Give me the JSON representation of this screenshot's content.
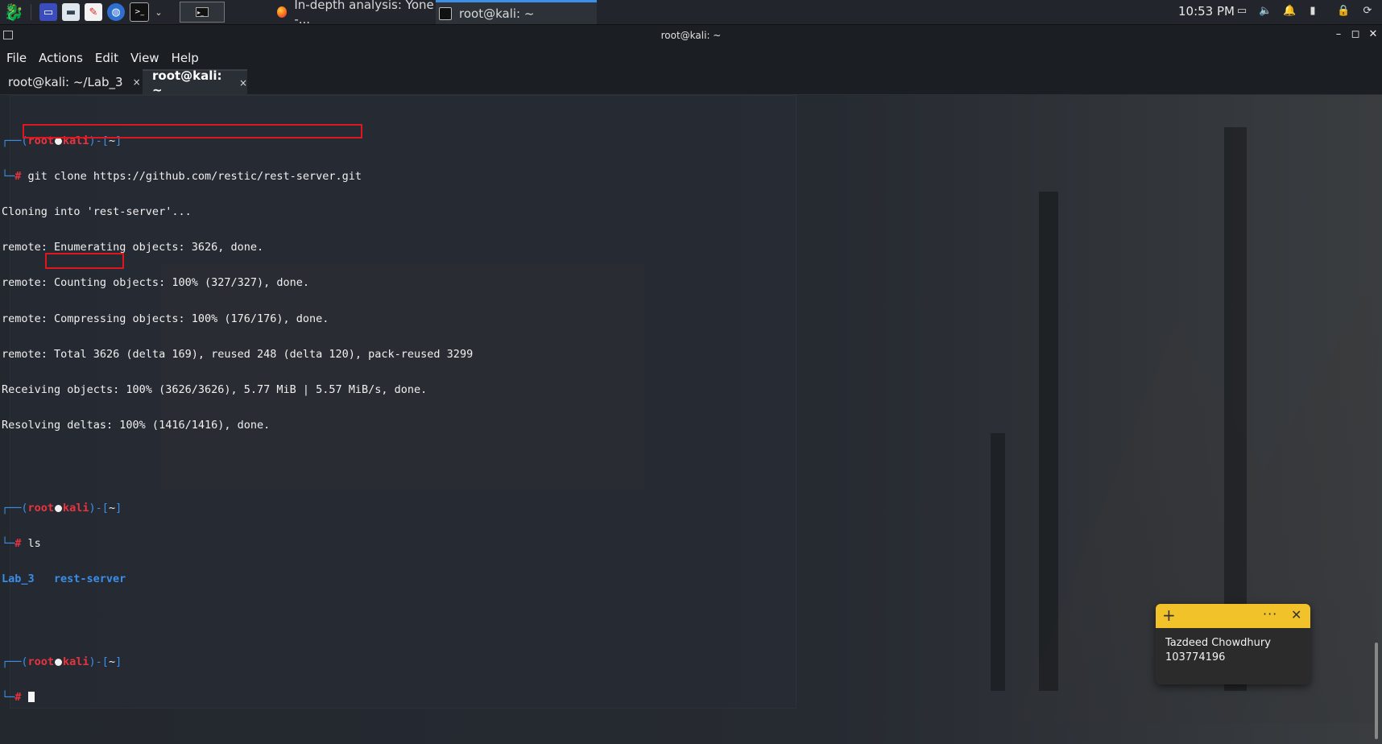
{
  "taskbar": {
    "tasks": [
      {
        "label": "In-depth analysis: Yone -..."
      },
      {
        "label": "root@kali: ~"
      }
    ],
    "clock": "10:53 PM"
  },
  "window": {
    "title": "root@kali: ~",
    "menu": [
      "File",
      "Actions",
      "Edit",
      "View",
      "Help"
    ],
    "tabs": [
      {
        "label": "root@kali: ~/Lab_3",
        "close": "×"
      },
      {
        "label": "root@kali: ~",
        "close": "×"
      }
    ]
  },
  "terminal": {
    "prompt": {
      "user": "root",
      "host": "kali",
      "dir": "~",
      "symbol": "#"
    },
    "blocks": [
      {
        "command": "git clone https://github.com/restic/rest-server.git",
        "output": [
          "Cloning into 'rest-server'...",
          "remote: Enumerating objects: 3626, done.",
          "remote: Counting objects: 100% (327/327), done.",
          "remote: Compressing objects: 100% (176/176), done.",
          "remote: Total 3626 (delta 169), reused 248 (delta 120), pack-reused 3299",
          "Receiving objects: 100% (3626/3626), 5.77 MiB | 5.57 MiB/s, done.",
          "Resolving deltas: 100% (1416/1416), done."
        ]
      },
      {
        "command": "ls",
        "ls_entries": [
          "Lab_3",
          "rest-server"
        ]
      }
    ]
  },
  "sticky_note": {
    "add": "+",
    "more": "···",
    "close": "✕",
    "lines": [
      "Tazdeed Chowdhury",
      "103774196"
    ]
  },
  "colors": {
    "prompt_blue": "#3b8ee8",
    "prompt_red": "#e8343e",
    "highlight_red": "#e0161e",
    "sticky_yellow": "#f2c22a"
  }
}
